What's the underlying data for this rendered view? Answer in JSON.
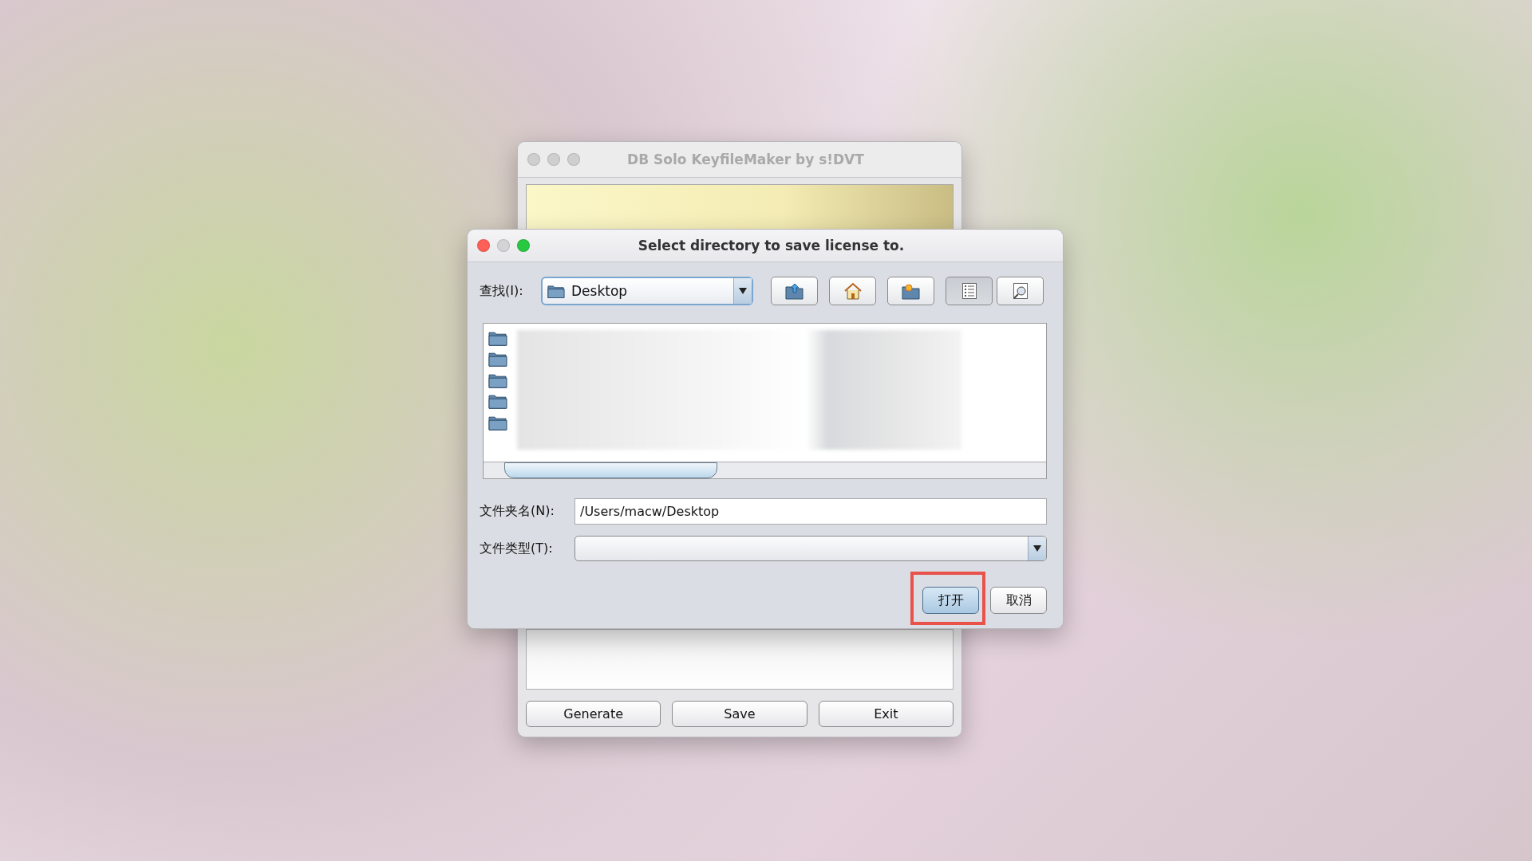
{
  "back_window": {
    "title": "DB Solo KeyfileMaker by s!DVT",
    "buttons": [
      "Generate",
      "Save",
      "Exit"
    ]
  },
  "dialog": {
    "title": "Select directory to save license to.",
    "look_in": {
      "label": "查找(I):",
      "value": "Desktop"
    },
    "toolbar_buttons": [
      {
        "kind": "up",
        "selected": false
      },
      {
        "kind": "home",
        "selected": false
      },
      {
        "kind": "new-folder",
        "selected": false
      },
      {
        "kind": "list",
        "selected": true
      },
      {
        "kind": "details",
        "selected": false
      }
    ],
    "folder_name": {
      "label": "文件夹名(N):",
      "value": "/Users/macw/Desktop"
    },
    "file_type": {
      "label": "文件类型(T):"
    },
    "buttons": [
      {
        "label": "打开",
        "highlighted": true
      },
      {
        "label": "取消",
        "highlighted": false
      }
    ]
  }
}
